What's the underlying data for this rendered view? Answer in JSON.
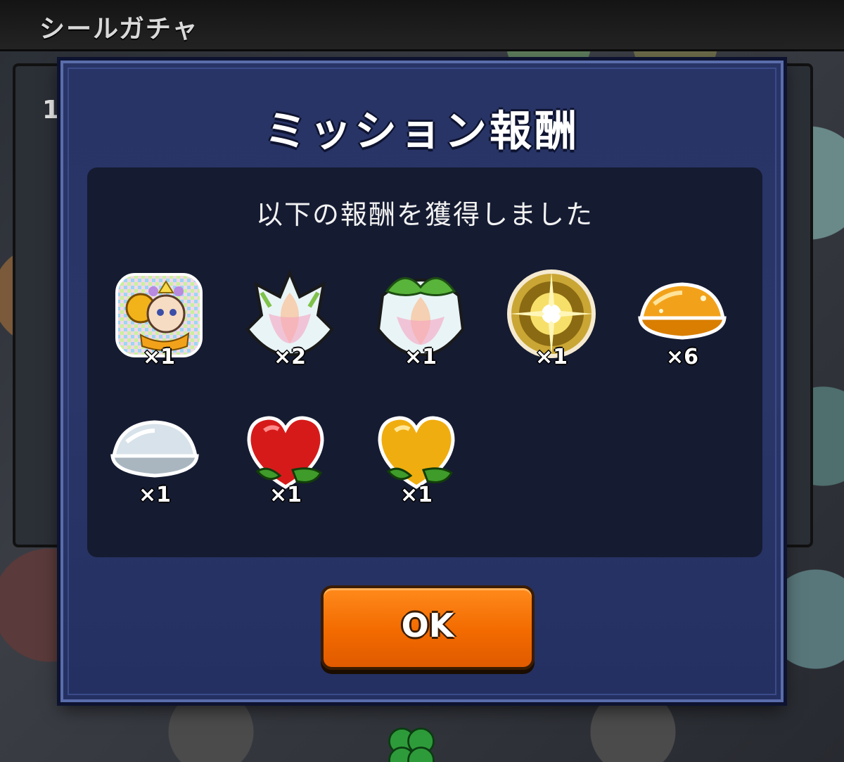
{
  "screen": {
    "title": "シールガチャ"
  },
  "background": {
    "partial_label": "1"
  },
  "dialog": {
    "title": "ミッション報酬",
    "subtitle": "以下の報酬を獲得しました",
    "rewards": [
      {
        "icon": "character-sticker-icon",
        "count": "×1"
      },
      {
        "icon": "white-lotus-fruit-icon",
        "count": "×2"
      },
      {
        "icon": "green-leaf-lotus-fruit-icon",
        "count": "×1"
      },
      {
        "icon": "golden-burst-orb-icon",
        "count": "×1"
      },
      {
        "icon": "gold-shell-icon",
        "count": "×6"
      },
      {
        "icon": "silver-shell-icon",
        "count": "×1"
      },
      {
        "icon": "red-heart-fruit-icon",
        "count": "×1"
      },
      {
        "icon": "gold-heart-fruit-icon",
        "count": "×1"
      }
    ],
    "ok_label": "OK"
  },
  "colors": {
    "dialog_bg": "#283466",
    "panel_bg": "#151b31",
    "ok_button": "#f26a00",
    "accent_gold": "#f2b21a"
  }
}
